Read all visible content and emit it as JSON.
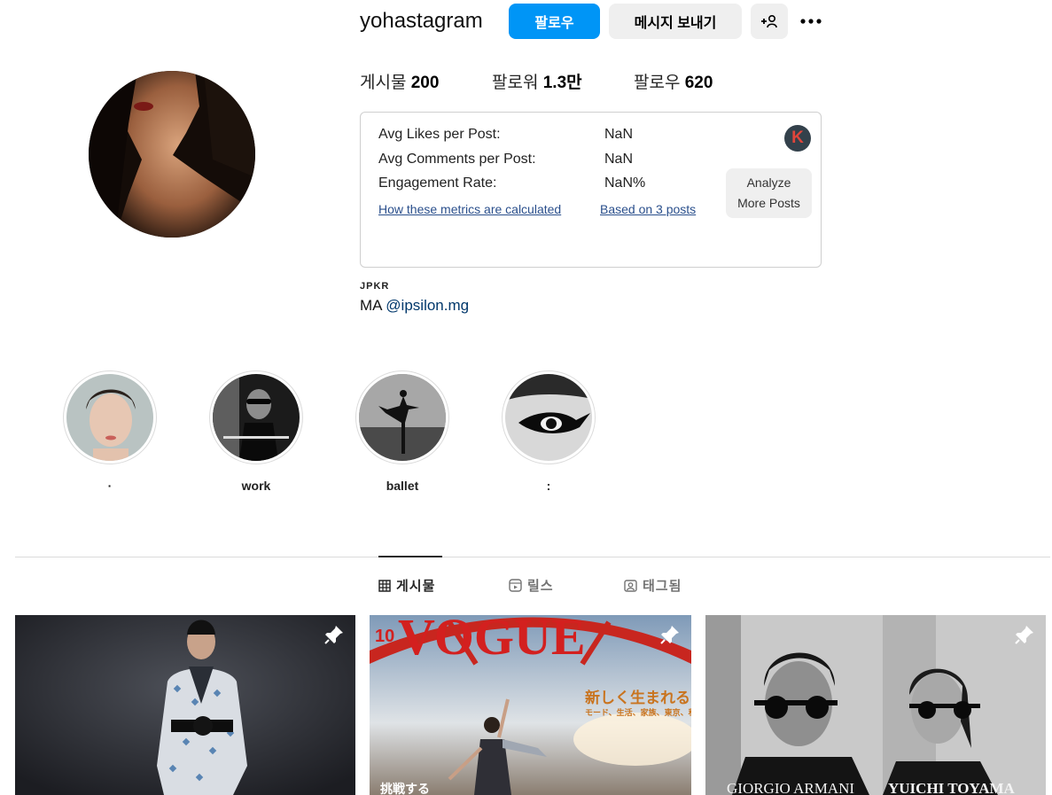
{
  "header": {
    "username": "yohastagram",
    "follow_label": "팔로우",
    "message_label": "메시지 보내기"
  },
  "stats": {
    "posts_label": "게시물",
    "posts_value": "200",
    "followers_label": "팔로워",
    "followers_value": "1.3만",
    "following_label": "팔로우",
    "following_value": "620"
  },
  "metrics": {
    "avg_likes_label": "Avg Likes per Post:",
    "avg_likes_value": "NaN",
    "avg_comments_label": "Avg Comments per Post:",
    "avg_comments_value": "NaN",
    "engagement_label": "Engagement Rate:",
    "engagement_value": "NaN%",
    "how_link": "How these metrics are calculated",
    "based_link": "Based on 3 posts",
    "analyze_line1": "Analyze",
    "analyze_line2": "More Posts",
    "logo_letter": "K"
  },
  "bio": {
    "category": "JPKR",
    "text_prefix": "MA ",
    "mention": "@ipsilon.mg"
  },
  "highlights": [
    {
      "label": "·"
    },
    {
      "label": "work"
    },
    {
      "label": "ballet"
    },
    {
      "label": ":"
    }
  ],
  "tabs": {
    "posts": "게시물",
    "reels": "릴스",
    "tagged": "태그됨"
  },
  "posts_images": {
    "vogue_issue": "10",
    "vogue_title": "VOGUE",
    "vogue_headline": "新しく生まれる",
    "vogue_sub": "モード、生活、家族、東京、私",
    "vogue_bottom": "挑戦する",
    "armani_1": "GIORGIO ARMANI",
    "armani_2": "YUICHI TOYAMA"
  },
  "colors": {
    "accent": "#0095f6",
    "link": "#00376b",
    "metrics_link": "#2a4f8c"
  }
}
